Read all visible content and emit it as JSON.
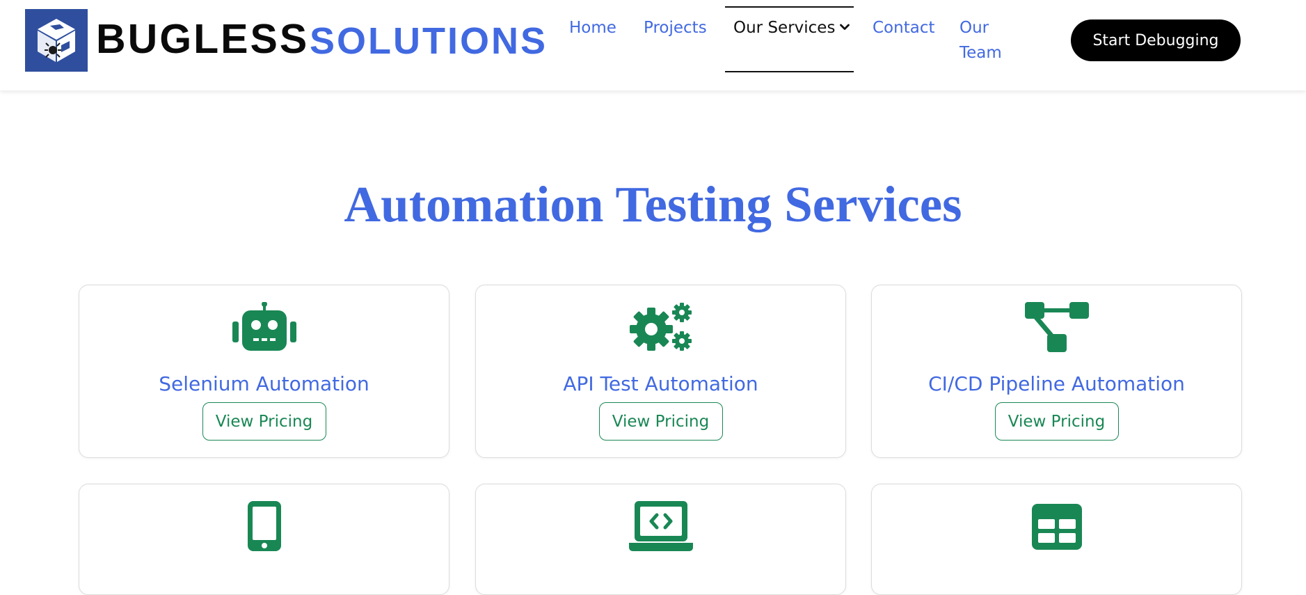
{
  "brand": {
    "name_part_1": "BUGLESS",
    "name_part_2": "SOLUTIONS",
    "logo_icon": "cube-logo-icon"
  },
  "nav": {
    "home": "Home",
    "projects": "Projects",
    "services": "Our Services",
    "contact": "Contact",
    "team": "Our Team",
    "cta": "Start Debugging"
  },
  "main": {
    "title": "Automation Testing Services",
    "cards": [
      {
        "icon": "robot-icon",
        "title": "Selenium Automation",
        "button": "View Pricing"
      },
      {
        "icon": "gears-icon",
        "title": "API Test Automation",
        "button": "View Pricing"
      },
      {
        "icon": "pipeline-diagram-icon",
        "title": "CI/CD Pipeline Automation",
        "button": "View Pricing"
      },
      {
        "icon": "mobile-phone-icon"
      },
      {
        "icon": "laptop-code-icon"
      },
      {
        "icon": "table-icon"
      }
    ]
  },
  "colors": {
    "brand_blue": "#4169e1",
    "logo_blue": "#2f4f9e",
    "icon_green": "#198754",
    "cta_bg": "#000000"
  }
}
